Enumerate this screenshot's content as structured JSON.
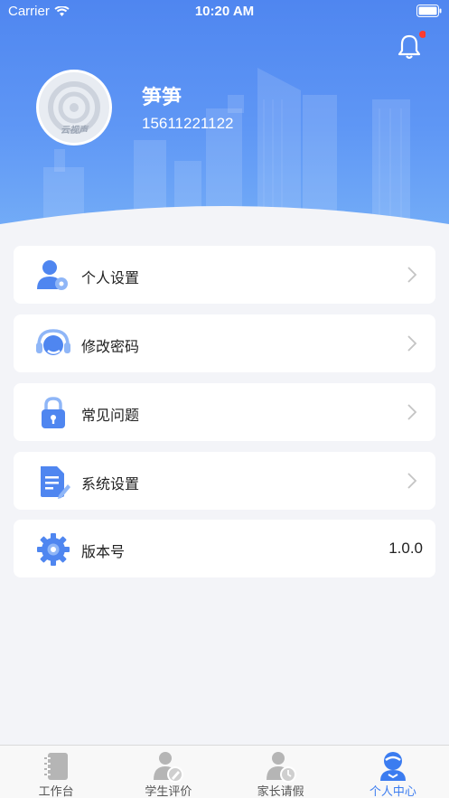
{
  "status_bar": {
    "carrier": "Carrier",
    "time": "10:20 AM"
  },
  "profile": {
    "avatar_brand": "云视声",
    "name": "笋笋",
    "phone": "15611221122"
  },
  "menu": [
    {
      "label": "个人设置",
      "icon": "user-settings-icon"
    },
    {
      "label": "修改密码",
      "icon": "headset-icon"
    },
    {
      "label": "常见问题",
      "icon": "lock-icon"
    },
    {
      "label": "系统设置",
      "icon": "document-edit-icon"
    },
    {
      "label": "版本号",
      "icon": "gear-icon",
      "value": "1.0.0"
    }
  ],
  "tabs": [
    {
      "label": "工作台",
      "icon": "notebook-icon",
      "active": false
    },
    {
      "label": "学生评价",
      "icon": "user-edit-icon",
      "active": false
    },
    {
      "label": "家长请假",
      "icon": "user-clock-icon",
      "active": false
    },
    {
      "label": "个人中心",
      "icon": "user-center-icon",
      "active": true
    }
  ],
  "colors": {
    "primary": "#4f86f0",
    "accent": "#3b7cf0",
    "badge": "#ff3b30",
    "background": "#f3f4f8"
  }
}
